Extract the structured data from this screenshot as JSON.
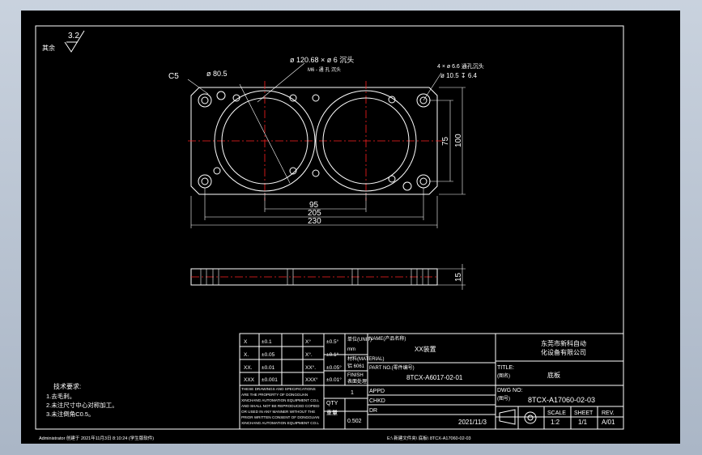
{
  "drawing": {
    "surface_roughness": "3.2",
    "remark_left": "其余",
    "callouts": {
      "chamfer": "C5",
      "small_bore": "ø 80.5",
      "big_bore": "ø 120.68 × ø  6 沉头",
      "thread": "M6 - 通 孔 沉头",
      "holes_a": "4 × ø  6.6 通孔沉头",
      "holes_b": "ø 10.5  ↧ 6.4"
    },
    "dims": {
      "d95": "95",
      "d205": "205",
      "d230": "230",
      "d75": "75",
      "d100": "100",
      "d15": "15"
    },
    "tech_req": {
      "title": "技术要求:",
      "lines": [
        "1.去毛刺。",
        "2.未注尺寸中心对称加工。",
        "3.未注倒角C0.5。"
      ]
    }
  },
  "title_block": {
    "tol": [
      {
        "a": "X",
        "b": "±0.1",
        "c": "X°",
        "d": "±0.5°"
      },
      {
        "a": "X.",
        "b": "±0.05",
        "c": "X°.",
        "d": "±0.1°"
      },
      {
        "a": "XX.",
        "b": "±0.01",
        "c": "XX°.",
        "d": "±0.05°"
      },
      {
        "a": "XXX",
        "b": "±0.001",
        "c": "XXX°",
        "d": "±0.01°"
      }
    ],
    "unit_label": "单位(UNIT)",
    "unit_value": "mm",
    "material_label": "材料(MATERIAL)",
    "material_value": "铝 6061",
    "finish_label": "FINISH",
    "finish_value": "表面处理",
    "notice": [
      "THESE DRAWINGS AND SPECIFICATIONS",
      "ARE THE PROPERTY OF DONGGUAN",
      "XINCHANG AUTOMATION EQUIPMENT CO.L",
      "AND SHALL NOT BE REPRODUCED COPIED",
      "OR USED IN ANY MANNER WITHOUT THE",
      "PRIOR WRITTEN CONSENT OF DONGGUAN",
      "XINCHANG AUTOMATION EQUIPMENT CO.L"
    ],
    "qty_label": "QTY",
    "qty_value": "1",
    "weight_label": "重量",
    "weight_value": "0.502",
    "name_label": "NAME(产品名称)",
    "name_value": "XX装置",
    "part_label": "PART NO.(零件编号)",
    "part_value": "8TCX-A6017-02-01",
    "appd_label": "APPD",
    "chkd_label": "CHKD",
    "dr_label": "DR",
    "date": "2021/11/3",
    "company_line1": "东莞市新科自动",
    "company_line2": "化设备有限公司",
    "title_label": "TITLE:",
    "title_cn": "(图名)",
    "title_value": "底板",
    "dwg_label": "DWG NO:",
    "dwg_cn": "(图号)",
    "dwg_value": "8TCX-A17060-02-03",
    "scale_label": "SCALE",
    "scale_value": "1:2",
    "sheet_label": "SHEET",
    "sheet_value": "1/1",
    "rev_label": "REV.",
    "rev_value": "A/01"
  },
  "status_bar": {
    "left": "Administrator  创建于 2021年11月3日 8:10:24  (学生版软件)",
    "right": "E:\\ 新建文件夹\\ 底板\\ 8TCX-A17060-02-03"
  }
}
